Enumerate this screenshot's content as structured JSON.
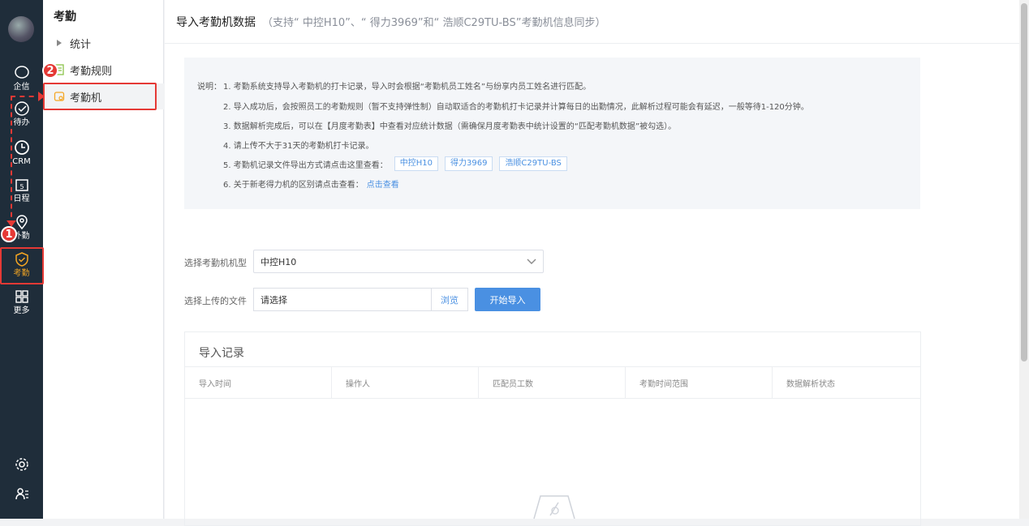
{
  "rail": {
    "items": [
      {
        "label": "企信",
        "icon": "chat-bubble-icon"
      },
      {
        "label": "待办",
        "icon": "check-circle-icon"
      },
      {
        "label": "CRM",
        "icon": "clock-icon"
      },
      {
        "label": "日程",
        "icon": "calendar-icon"
      },
      {
        "label": "外勤",
        "icon": "location-pin-icon"
      },
      {
        "label": "考勤",
        "icon": "attendance-check-icon"
      },
      {
        "label": "更多",
        "icon": "grid-icon"
      }
    ],
    "bottom_icons": [
      "gear-icon",
      "user-list-icon"
    ],
    "active_color": "#f5a623"
  },
  "annotations": {
    "badge1": "1",
    "badge2": "2",
    "color": "#e53935"
  },
  "sub": {
    "title": "考勤",
    "items": [
      {
        "label": "统计",
        "icon": "caret-right-icon"
      },
      {
        "label": "考勤规则",
        "icon": "rules-doc-icon"
      },
      {
        "label": "考勤机",
        "icon": "machine-icon"
      }
    ]
  },
  "header": {
    "title": "导入考勤机数据",
    "subtitle": "（支持“ 中控H10”、“ 得力3969”和“ 浩顺C29TU-BS”考勤机信息同步）"
  },
  "note": {
    "label": "说明：",
    "lines": [
      "1. 考勤系统支持导入考勤机的打卡记录，导入时会根据“考勤机员工姓名”与纷享内员工姓名进行匹配。",
      "2. 导入成功后，会按照员工的考勤规则（暂不支持弹性制）自动取适合的考勤机打卡记录并计算每日的出勤情况，此解析过程可能会有延迟，一般等待1-120分钟。",
      "3. 数据解析完成后，可以在【月度考勤表】中查看对应统计数据（需确保月度考勤表中统计设置的“匹配考勤机数据”被勾选）。",
      "4. 请上传不大于31天的考勤机打卡记录。",
      "5. 考勤机记录文件导出方式请点击这里查看：",
      "6. 关于新老得力机的区别请点击查看："
    ],
    "tags": [
      "中控H10",
      "得力3969",
      "浩顺C29TU-BS"
    ],
    "link": "点击查看"
  },
  "form": {
    "machine_label": "选择考勤机机型",
    "machine_value": "中控H10",
    "file_label": "选择上传的文件",
    "file_placeholder": "请选择",
    "browse": "浏览",
    "start": "开始导入"
  },
  "records": {
    "title": "导入记录",
    "columns": [
      "导入时间",
      "操作人",
      "匹配员工数",
      "考勤时间范围",
      "数据解析状态"
    ]
  },
  "colors": {
    "primary": "#4a90e2",
    "rail_bg": "#1f2d3a"
  }
}
